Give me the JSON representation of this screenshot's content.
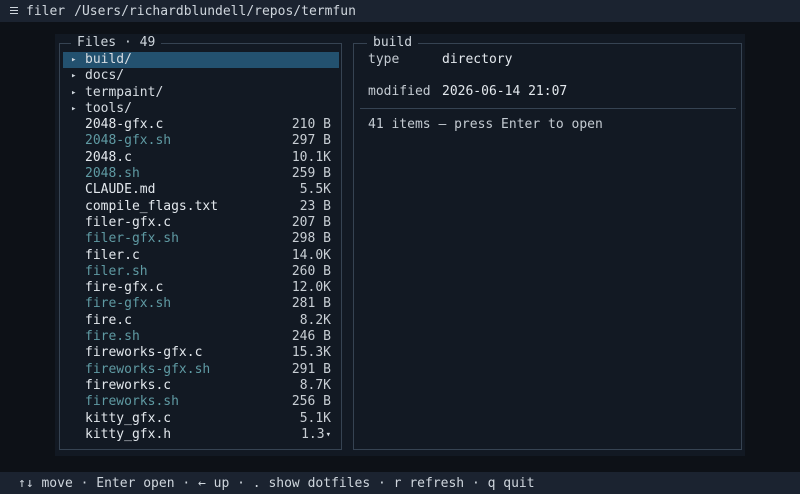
{
  "titlebar": {
    "app": "filer",
    "path": "/Users/richardblundell/repos/termfun"
  },
  "files_panel": {
    "title": "Files · 49",
    "items": [
      {
        "kind": "dir",
        "name": "build/",
        "size": "",
        "selected": true
      },
      {
        "kind": "dir",
        "name": "docs/",
        "size": ""
      },
      {
        "kind": "dir",
        "name": "termpaint/",
        "size": ""
      },
      {
        "kind": "dir",
        "name": "tools/",
        "size": ""
      },
      {
        "kind": "file",
        "name": "2048-gfx.c",
        "size": "210 B"
      },
      {
        "kind": "sh",
        "name": "2048-gfx.sh",
        "size": "297 B"
      },
      {
        "kind": "file",
        "name": "2048.c",
        "size": "10.1K"
      },
      {
        "kind": "sh",
        "name": "2048.sh",
        "size": "259 B"
      },
      {
        "kind": "file",
        "name": "CLAUDE.md",
        "size": "5.5K"
      },
      {
        "kind": "file",
        "name": "compile_flags.txt",
        "size": "23 B"
      },
      {
        "kind": "file",
        "name": "filer-gfx.c",
        "size": "207 B"
      },
      {
        "kind": "sh",
        "name": "filer-gfx.sh",
        "size": "298 B"
      },
      {
        "kind": "file",
        "name": "filer.c",
        "size": "14.0K"
      },
      {
        "kind": "sh",
        "name": "filer.sh",
        "size": "260 B"
      },
      {
        "kind": "file",
        "name": "fire-gfx.c",
        "size": "12.0K"
      },
      {
        "kind": "sh",
        "name": "fire-gfx.sh",
        "size": "281 B"
      },
      {
        "kind": "file",
        "name": "fire.c",
        "size": "8.2K"
      },
      {
        "kind": "sh",
        "name": "fire.sh",
        "size": "246 B"
      },
      {
        "kind": "file",
        "name": "fireworks-gfx.c",
        "size": "15.3K"
      },
      {
        "kind": "sh",
        "name": "fireworks-gfx.sh",
        "size": "291 B"
      },
      {
        "kind": "file",
        "name": "fireworks.c",
        "size": "8.7K"
      },
      {
        "kind": "sh",
        "name": "fireworks.sh",
        "size": "256 B"
      },
      {
        "kind": "file",
        "name": "kitty_gfx.c",
        "size": "5.1K"
      },
      {
        "kind": "file",
        "name": "kitty_gfx.h",
        "size": "1.3",
        "more": true
      }
    ],
    "dir_arrow": "▸",
    "more_arrow": "▾"
  },
  "detail_panel": {
    "title": "build",
    "type_label": "type",
    "type_value": "directory",
    "modified_label": "modified",
    "modified_value": "2026-06-14 21:07",
    "hint": "41 items — press Enter to open"
  },
  "statusbar": {
    "text": "↑↓ move · Enter open · ← up · . show dotfiles · r refresh · q quit"
  },
  "colors": {
    "background": "#0d1117",
    "selection": "#23516f",
    "script_file": "#5f9aa3",
    "border": "#364352"
  }
}
